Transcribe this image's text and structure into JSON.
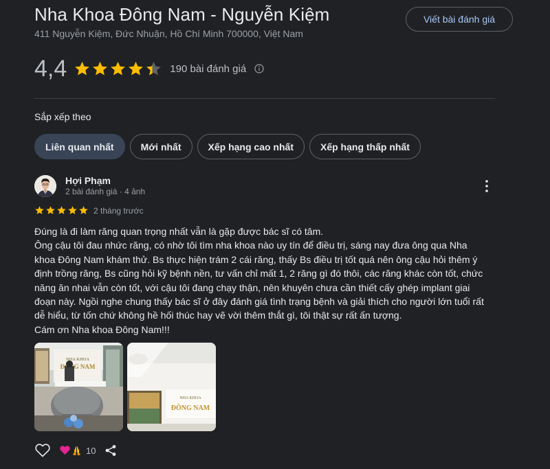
{
  "place": {
    "title": "Nha Khoa Đông Nam - Nguyễn Kiệm",
    "address": "411 Nguyễn Kiệm, Đức Nhuận, Hồ Chí Minh 700000, Việt Nam",
    "write_review_label": "Viết bài đánh giá"
  },
  "rating": {
    "value": "4,4",
    "stars": 4.4,
    "count_label": "190 bài đánh giá",
    "star_color": "#fbbc04"
  },
  "sort": {
    "label": "Sắp xếp theo",
    "options": [
      "Liên quan nhất",
      "Mới nhất",
      "Xếp hạng cao nhất",
      "Xếp hạng thấp nhất"
    ],
    "selected": "Liên quan nhất"
  },
  "review": {
    "author": "Hợi Phạm",
    "meta": "2 bài đánh giá · 4 ảnh",
    "stars": 5,
    "time": "2 tháng trước",
    "lines": [
      "Đúng là đi làm răng quan trọng nhất vẫn là gặp được bác sĩ có tâm.",
      "Ông cậu tôi đau nhức răng, có nhờ tôi tìm nha khoa nào uy tín để điều trị, sáng nay đưa ông qua Nha",
      "khoa Đông Nam khám thử. Bs thực hiện trám 2 cái răng, thấy Bs điều trị tốt quá nên ông cậu hỏi thêm ý",
      "định trồng răng, Bs cũng hỏi kỹ bệnh nền, tư vấn chỉ mất 1, 2 răng gì đó thôi, các răng khác còn tốt, chức",
      "năng ăn nhai vẫn còn tốt, với cậu tôi đang chạy thận, nên khuyên chưa cần thiết cấy ghép implant giai",
      "đoạn này. Ngồi nghe chung thấy bác sĩ ở đây đánh giá tình trạng bệnh và giải thích cho người lớn tuổi rất",
      "dễ hiểu, từ tốn chứ không hề hối thúc hay vẽ vời thêm thắt gì, tôi thật sự rất ấn tượng.",
      "Cám ơn Nha khoa Đông Nam!!!"
    ],
    "photo_sign_text": "NHA KHOA ĐÔNG NAM",
    "reaction_icons": [
      "heart-icon",
      "praying-hands-icon"
    ],
    "reaction_count": "10"
  },
  "colors": {
    "background": "#202124",
    "accent_blue": "#a8c7fa",
    "active_chip": "#394457",
    "star": "#fbbc04"
  }
}
